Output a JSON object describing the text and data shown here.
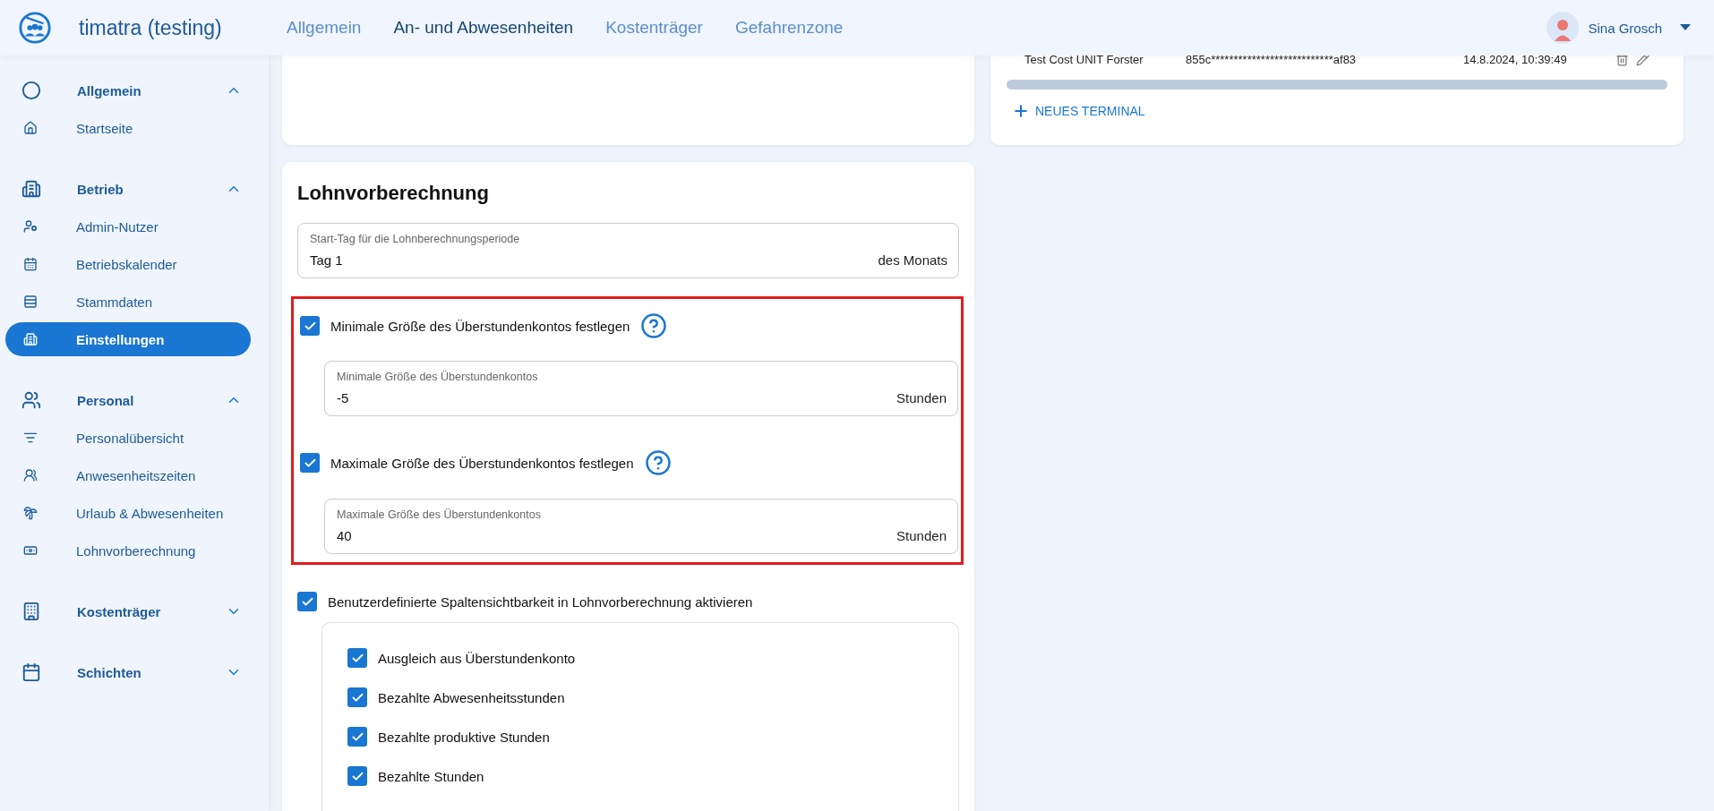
{
  "app": {
    "title": "timatra (testing)"
  },
  "nav_tabs": [
    {
      "label": "Allgemein",
      "selected": false
    },
    {
      "label": "An- und Abwesenheiten",
      "selected": true
    },
    {
      "label": "Kostenträger",
      "selected": false
    },
    {
      "label": "Gefahrenzone",
      "selected": false
    }
  ],
  "user": {
    "name": "Sina Grosch"
  },
  "sidebar": {
    "groups": [
      {
        "label": "Allgemein",
        "expanded": true,
        "items": [
          {
            "label": "Startseite",
            "selected": false
          }
        ]
      },
      {
        "label": "Betrieb",
        "expanded": true,
        "items": [
          {
            "label": "Admin-Nutzer",
            "selected": false
          },
          {
            "label": "Betriebskalender",
            "selected": false
          },
          {
            "label": "Stammdaten",
            "selected": false
          },
          {
            "label": "Einstellungen",
            "selected": true
          }
        ]
      },
      {
        "label": "Personal",
        "expanded": true,
        "items": [
          {
            "label": "Personalübersicht",
            "selected": false
          },
          {
            "label": "Anwesenheitszeiten",
            "selected": false
          },
          {
            "label": "Urlaub & Abwesenheiten",
            "selected": false
          },
          {
            "label": "Lohnvorberechnung",
            "selected": false
          }
        ]
      },
      {
        "label": "Kostenträger",
        "expanded": false
      },
      {
        "label": "Schichten",
        "expanded": false
      }
    ]
  },
  "terminals": {
    "rows": [
      {
        "name": "Test Cost UNIT Forster",
        "key": "855c***************************af83",
        "date": "14.8.2024, 10:39:49"
      }
    ],
    "add_button": "NEUES TERMINAL"
  },
  "payroll": {
    "title": "Lohnvorberechnung",
    "start_field": {
      "label": "Start-Tag für die Lohnberechnungsperiode",
      "value": "Tag 1",
      "suffix": "des Monats"
    },
    "limits": {
      "highlighted": true,
      "items": [
        {
          "label": "Minimale Größe des Überstundenkontos festlegen",
          "checked": true,
          "field": {
            "label": "Minimale Größe des Überstundenkontos",
            "value": "-5",
            "suffix": "Stunden"
          }
        },
        {
          "label": "Maximale Größe des Überstundenkontos festlegen",
          "checked": true,
          "field": {
            "label": "Maximale Größe des Überstundenkontos",
            "value": "40",
            "suffix": "Stunden"
          }
        }
      ]
    },
    "column_visibility": {
      "label": "Benutzerdefinierte Spaltensichtbarkeit in Lohnvorberechnung aktivieren",
      "checked": true,
      "columns": [
        {
          "label": "Ausgleich aus Überstundenkonto",
          "checked": true
        },
        {
          "label": "Bezahlte Abwesenheitsstunden",
          "checked": true
        },
        {
          "label": "Bezahlte produktive Stunden",
          "checked": true
        },
        {
          "label": "Bezahlte Stunden",
          "checked": true
        }
      ]
    }
  }
}
